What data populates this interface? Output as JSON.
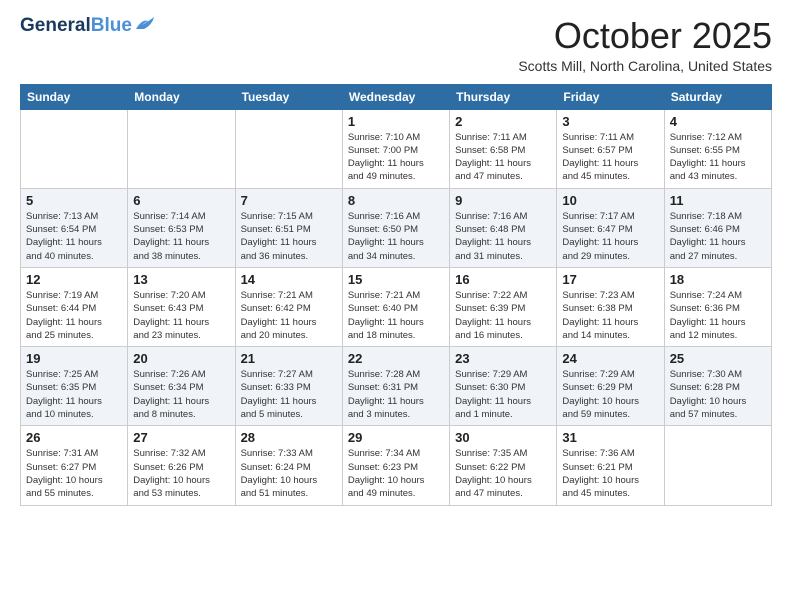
{
  "header": {
    "logo_line1": "General",
    "logo_line2": "Blue",
    "month": "October 2025",
    "location": "Scotts Mill, North Carolina, United States"
  },
  "weekdays": [
    "Sunday",
    "Monday",
    "Tuesday",
    "Wednesday",
    "Thursday",
    "Friday",
    "Saturday"
  ],
  "weeks": [
    [
      {
        "day": "",
        "info": ""
      },
      {
        "day": "",
        "info": ""
      },
      {
        "day": "",
        "info": ""
      },
      {
        "day": "1",
        "info": "Sunrise: 7:10 AM\nSunset: 7:00 PM\nDaylight: 11 hours\nand 49 minutes."
      },
      {
        "day": "2",
        "info": "Sunrise: 7:11 AM\nSunset: 6:58 PM\nDaylight: 11 hours\nand 47 minutes."
      },
      {
        "day": "3",
        "info": "Sunrise: 7:11 AM\nSunset: 6:57 PM\nDaylight: 11 hours\nand 45 minutes."
      },
      {
        "day": "4",
        "info": "Sunrise: 7:12 AM\nSunset: 6:55 PM\nDaylight: 11 hours\nand 43 minutes."
      }
    ],
    [
      {
        "day": "5",
        "info": "Sunrise: 7:13 AM\nSunset: 6:54 PM\nDaylight: 11 hours\nand 40 minutes."
      },
      {
        "day": "6",
        "info": "Sunrise: 7:14 AM\nSunset: 6:53 PM\nDaylight: 11 hours\nand 38 minutes."
      },
      {
        "day": "7",
        "info": "Sunrise: 7:15 AM\nSunset: 6:51 PM\nDaylight: 11 hours\nand 36 minutes."
      },
      {
        "day": "8",
        "info": "Sunrise: 7:16 AM\nSunset: 6:50 PM\nDaylight: 11 hours\nand 34 minutes."
      },
      {
        "day": "9",
        "info": "Sunrise: 7:16 AM\nSunset: 6:48 PM\nDaylight: 11 hours\nand 31 minutes."
      },
      {
        "day": "10",
        "info": "Sunrise: 7:17 AM\nSunset: 6:47 PM\nDaylight: 11 hours\nand 29 minutes."
      },
      {
        "day": "11",
        "info": "Sunrise: 7:18 AM\nSunset: 6:46 PM\nDaylight: 11 hours\nand 27 minutes."
      }
    ],
    [
      {
        "day": "12",
        "info": "Sunrise: 7:19 AM\nSunset: 6:44 PM\nDaylight: 11 hours\nand 25 minutes."
      },
      {
        "day": "13",
        "info": "Sunrise: 7:20 AM\nSunset: 6:43 PM\nDaylight: 11 hours\nand 23 minutes."
      },
      {
        "day": "14",
        "info": "Sunrise: 7:21 AM\nSunset: 6:42 PM\nDaylight: 11 hours\nand 20 minutes."
      },
      {
        "day": "15",
        "info": "Sunrise: 7:21 AM\nSunset: 6:40 PM\nDaylight: 11 hours\nand 18 minutes."
      },
      {
        "day": "16",
        "info": "Sunrise: 7:22 AM\nSunset: 6:39 PM\nDaylight: 11 hours\nand 16 minutes."
      },
      {
        "day": "17",
        "info": "Sunrise: 7:23 AM\nSunset: 6:38 PM\nDaylight: 11 hours\nand 14 minutes."
      },
      {
        "day": "18",
        "info": "Sunrise: 7:24 AM\nSunset: 6:36 PM\nDaylight: 11 hours\nand 12 minutes."
      }
    ],
    [
      {
        "day": "19",
        "info": "Sunrise: 7:25 AM\nSunset: 6:35 PM\nDaylight: 11 hours\nand 10 minutes."
      },
      {
        "day": "20",
        "info": "Sunrise: 7:26 AM\nSunset: 6:34 PM\nDaylight: 11 hours\nand 8 minutes."
      },
      {
        "day": "21",
        "info": "Sunrise: 7:27 AM\nSunset: 6:33 PM\nDaylight: 11 hours\nand 5 minutes."
      },
      {
        "day": "22",
        "info": "Sunrise: 7:28 AM\nSunset: 6:31 PM\nDaylight: 11 hours\nand 3 minutes."
      },
      {
        "day": "23",
        "info": "Sunrise: 7:29 AM\nSunset: 6:30 PM\nDaylight: 11 hours\nand 1 minute."
      },
      {
        "day": "24",
        "info": "Sunrise: 7:29 AM\nSunset: 6:29 PM\nDaylight: 10 hours\nand 59 minutes."
      },
      {
        "day": "25",
        "info": "Sunrise: 7:30 AM\nSunset: 6:28 PM\nDaylight: 10 hours\nand 57 minutes."
      }
    ],
    [
      {
        "day": "26",
        "info": "Sunrise: 7:31 AM\nSunset: 6:27 PM\nDaylight: 10 hours\nand 55 minutes."
      },
      {
        "day": "27",
        "info": "Sunrise: 7:32 AM\nSunset: 6:26 PM\nDaylight: 10 hours\nand 53 minutes."
      },
      {
        "day": "28",
        "info": "Sunrise: 7:33 AM\nSunset: 6:24 PM\nDaylight: 10 hours\nand 51 minutes."
      },
      {
        "day": "29",
        "info": "Sunrise: 7:34 AM\nSunset: 6:23 PM\nDaylight: 10 hours\nand 49 minutes."
      },
      {
        "day": "30",
        "info": "Sunrise: 7:35 AM\nSunset: 6:22 PM\nDaylight: 10 hours\nand 47 minutes."
      },
      {
        "day": "31",
        "info": "Sunrise: 7:36 AM\nSunset: 6:21 PM\nDaylight: 10 hours\nand 45 minutes."
      },
      {
        "day": "",
        "info": ""
      }
    ]
  ]
}
